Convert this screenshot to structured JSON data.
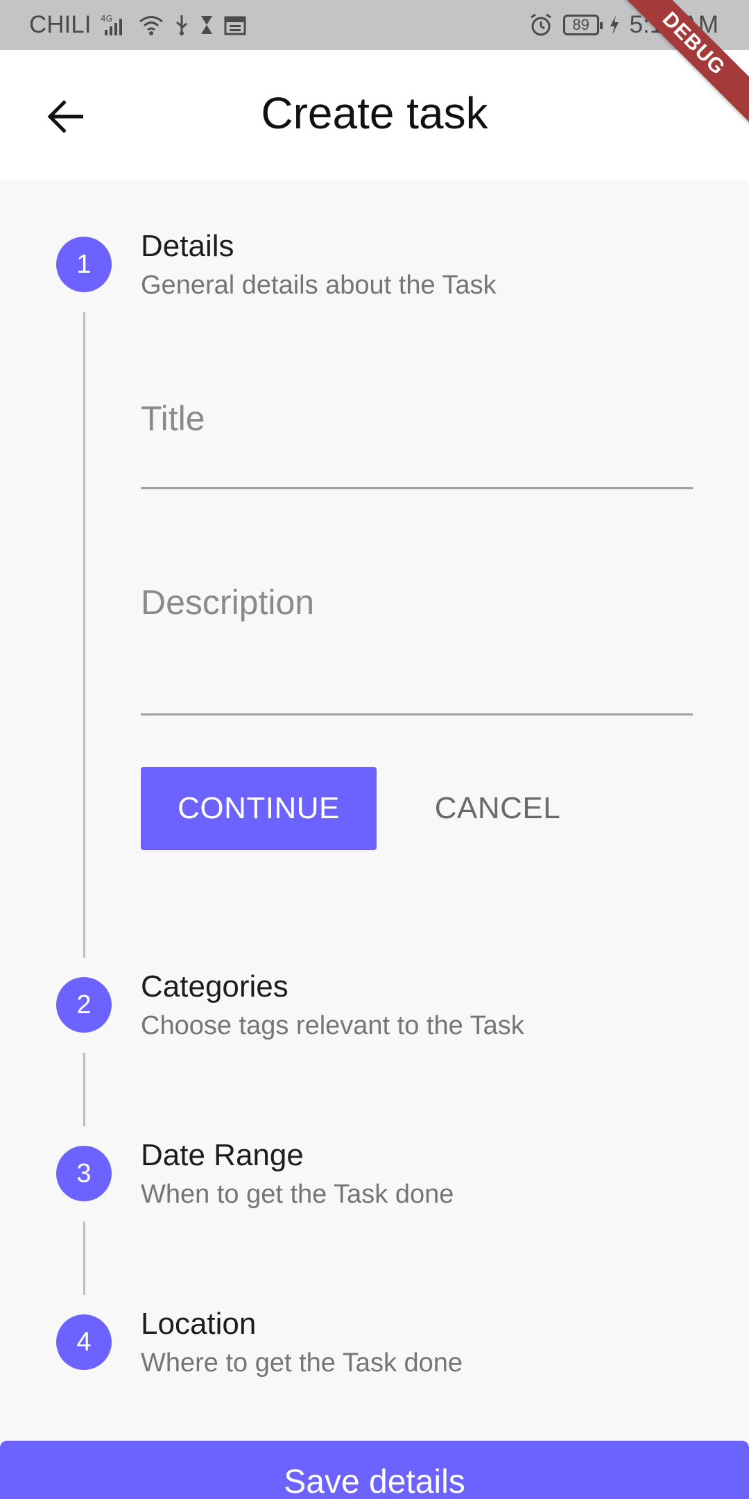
{
  "status_bar": {
    "carrier": "CHILI",
    "network": "4G",
    "battery": "89",
    "time": "5:13 AM"
  },
  "debug_banner": "DEBUG",
  "app_bar": {
    "title": "Create task",
    "back_icon": "arrow-left-icon"
  },
  "steps": [
    {
      "number": "1",
      "title": "Details",
      "subtitle": "General details about the Task"
    },
    {
      "number": "2",
      "title": "Categories",
      "subtitle": "Choose tags relevant to the Task"
    },
    {
      "number": "3",
      "title": "Date Range",
      "subtitle": "When to get the Task done"
    },
    {
      "number": "4",
      "title": "Location",
      "subtitle": "Where to get the Task done"
    }
  ],
  "form": {
    "title_placeholder": "Title",
    "title_value": "",
    "description_placeholder": "Description",
    "description_value": ""
  },
  "buttons": {
    "continue": "CONTINUE",
    "cancel": "CANCEL",
    "save": "Save details"
  },
  "colors": {
    "accent": "#6c63ff",
    "status_bar": "#c4c4c4",
    "debug_banner": "#a43a3a"
  }
}
